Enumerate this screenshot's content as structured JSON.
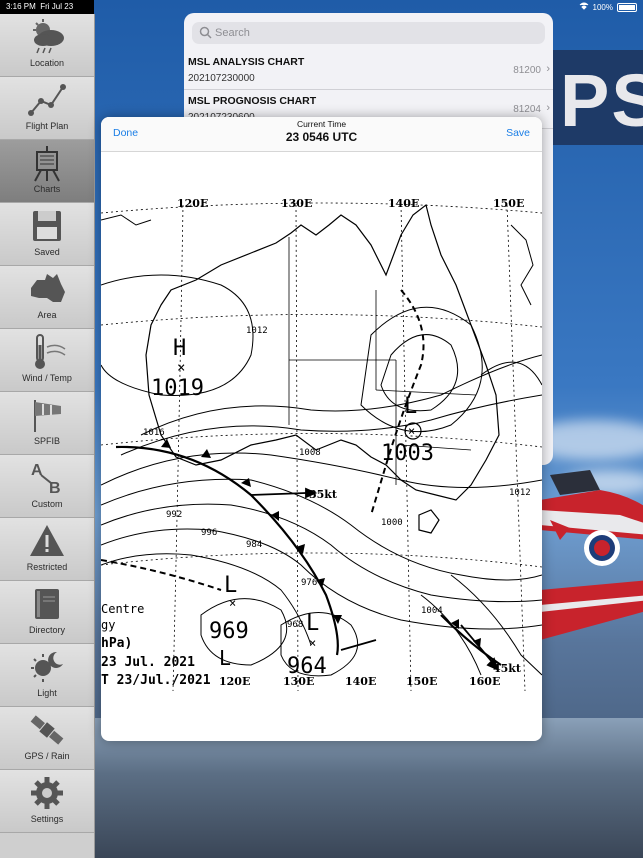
{
  "status": {
    "time": "3:16 PM",
    "date": "Fri Jul 23",
    "battery": "100%"
  },
  "sidebar": {
    "items": [
      {
        "label": "Location",
        "icon": "weather-cloud-icon"
      },
      {
        "label": "Flight Plan",
        "icon": "route-graph-icon"
      },
      {
        "label": "Charts",
        "icon": "easel-icon"
      },
      {
        "label": "Saved",
        "icon": "floppy-disk-icon"
      },
      {
        "label": "Area",
        "icon": "australia-map-icon"
      },
      {
        "label": "Wind / Temp",
        "icon": "thermometer-icon"
      },
      {
        "label": "SPFIB",
        "icon": "windsock-icon"
      },
      {
        "label": "Custom",
        "icon": "a-to-b-icon"
      },
      {
        "label": "Restricted",
        "icon": "warning-triangle-icon"
      },
      {
        "label": "Directory",
        "icon": "book-icon"
      },
      {
        "label": "Light",
        "icon": "sun-moon-icon"
      },
      {
        "label": "GPS / Rain",
        "icon": "satellite-icon"
      },
      {
        "label": "Settings",
        "icon": "gear-icon"
      }
    ],
    "active": "Charts"
  },
  "list": {
    "search_placeholder": "Search",
    "rows": [
      {
        "title": "MSL ANALYSIS CHART",
        "subtitle": "202107230000",
        "code": "81200"
      },
      {
        "title": "MSL PROGNOSIS CHART",
        "subtitle": "202107230600",
        "code": "81204"
      }
    ]
  },
  "modal": {
    "done_label": "Done",
    "save_label": "Save",
    "caption": "Current Time",
    "time": "23 0546 UTC"
  },
  "chart": {
    "longitudes": [
      "120E",
      "130E",
      "140E",
      "150E"
    ],
    "bottom_longitudes": [
      "120E",
      "130E",
      "140E",
      "150E",
      "160E"
    ],
    "pressure_systems": [
      {
        "type": "H",
        "value": "1019"
      },
      {
        "type": "L",
        "value": "1003"
      },
      {
        "type": "L",
        "value": "969"
      },
      {
        "type": "L",
        "value": "964"
      }
    ],
    "isobar_labels": [
      "1012",
      "1008",
      "1016",
      "1000",
      "996",
      "992",
      "984",
      "976",
      "968",
      "1004",
      "1012"
    ],
    "wind_labels": [
      "35kt",
      "45kt"
    ],
    "legend_lines": [
      "Centre",
      "gy",
      "hPa)",
      "23 Jul. 2021",
      "T 23/Jul./2021"
    ]
  },
  "colors": {
    "link": "#1a7ee6",
    "sidebar_active": "#8a8a8a"
  }
}
